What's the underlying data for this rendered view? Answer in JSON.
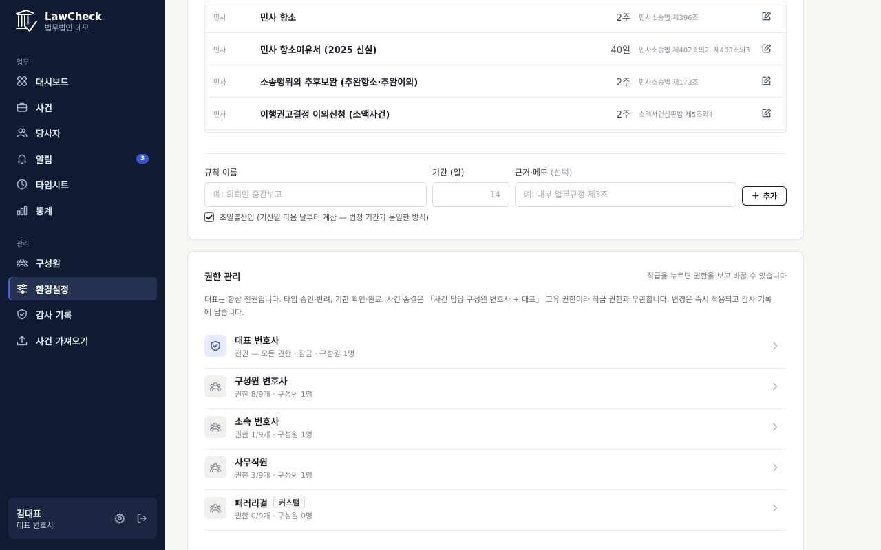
{
  "app": {
    "name": "LawCheck",
    "org": "법무법인 데모"
  },
  "sidebar": {
    "sections": [
      {
        "title": "업무",
        "items": [
          {
            "label": "대시보드",
            "icon": "grid-icon"
          },
          {
            "label": "사건",
            "icon": "briefcase-icon"
          },
          {
            "label": "당사자",
            "icon": "users-icon"
          },
          {
            "label": "알림",
            "icon": "bell-icon",
            "badge": "3"
          },
          {
            "label": "타임시트",
            "icon": "clock-icon"
          },
          {
            "label": "통계",
            "icon": "bar-chart-icon"
          }
        ]
      },
      {
        "title": "관리",
        "items": [
          {
            "label": "구성원",
            "icon": "team-icon"
          },
          {
            "label": "환경설정",
            "icon": "sliders-icon",
            "active": true
          },
          {
            "label": "감사 기록",
            "icon": "shield-icon"
          },
          {
            "label": "사건 가져오기",
            "icon": "upload-icon"
          }
        ]
      }
    ]
  },
  "user": {
    "name": "김대표",
    "role": "대표 변호사"
  },
  "rules": {
    "rows": [
      {
        "category": "민사",
        "name": "민사 항소",
        "period": "2주",
        "basis": "민사소송법 제396조"
      },
      {
        "category": "민사",
        "name": "민사 항소이유서 (2025 신설)",
        "period": "40일",
        "basis": "민사소송법 제402조의2, 제402조의3"
      },
      {
        "category": "민사",
        "name": "소송행위의 추후보완 (추완항소·추완이의)",
        "period": "2주",
        "basis": "민사소송법 제173조"
      },
      {
        "category": "민사",
        "name": "이행권고결정 이의신청 (소액사건)",
        "period": "2주",
        "basis": "소액사건심판법 제5조의4"
      }
    ],
    "form": {
      "name_label": "규칙 이름",
      "name_placeholder": "예: 의뢰인 중간보고",
      "period_label": "기간 (일)",
      "period_placeholder": "14",
      "memo_label": "근거·메모",
      "memo_optional": "(선택)",
      "memo_placeholder": "예: 내부 업무규정 제3조",
      "add_label": "추가",
      "checkbox_label": "초일불산입 (기산일 다음 날부터 계산 — 법정 기간과 동일한 방식)",
      "checkbox_checked": true
    }
  },
  "permissions": {
    "title": "권한 관리",
    "hint": "직급을 누르면 권한을 보고 바꿀 수 있습니다",
    "description": "대표는 항상 전권입니다. 타임 승인·반려, 기한 확인·완료, 사건 종결은 「사건 담당 구성원 변호사 + 대표」 고유 권한이라 직급 권한과 무관합니다. 변경은 즉시 적용되고 감사 기록에 남습니다.",
    "roles": [
      {
        "name": "대표 변호사",
        "meta": "전권 — 모든 권한 · 잠금 · 구성원 1명",
        "primary": true
      },
      {
        "name": "구성원 변호사",
        "meta": "권한 8/9개 · 구성원 1명"
      },
      {
        "name": "소속 변호사",
        "meta": "권한 1/9개 · 구성원 1명"
      },
      {
        "name": "사무직원",
        "meta": "권한 3/9개 · 구성원 1명"
      },
      {
        "name": "패러리걸",
        "meta": "권한 0/9개 · 구성원 0명",
        "chip": "커스텀"
      }
    ]
  },
  "colors": {
    "sidebar_bg": "#101b33",
    "accent": "#3554d1",
    "page_bg": "#f7f6f3"
  }
}
